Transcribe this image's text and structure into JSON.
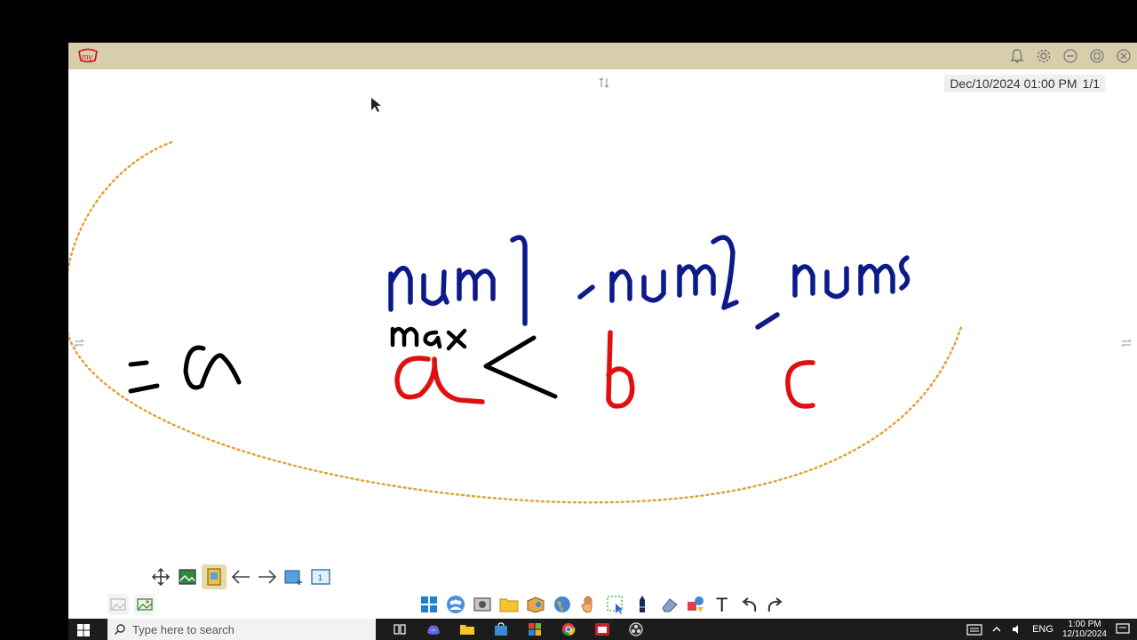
{
  "window": {
    "logo_text": "my",
    "title_icons": [
      "bell-icon",
      "gear-icon",
      "minimize-icon",
      "restore-icon",
      "close-icon"
    ]
  },
  "datestamp": {
    "datetime": "Dec/10/2024 01:00 PM",
    "page": "1/1"
  },
  "page_toolbar": {
    "icons": [
      "move-icon",
      "screenshot-icon",
      "page-list-icon",
      "arrow-left-icon",
      "arrow-right-icon",
      "add-page-icon",
      "page-number-icon"
    ],
    "active_index": 2,
    "page_number": "1"
  },
  "main_toolbar": {
    "icons": [
      "windows-icon",
      "people-icon",
      "camera-icon",
      "folder-icon",
      "box-icon",
      "globe-icon",
      "hand-icon",
      "select-icon",
      "pen-icon",
      "eraser-icon",
      "shapes-icon",
      "text-icon",
      "undo-icon",
      "redo-icon"
    ],
    "text_glyph": "T"
  },
  "taskbar": {
    "search_placeholder": "Type here to search",
    "apps": [
      "task-view-icon",
      "copilot-icon",
      "file-explorer-icon",
      "store-icon",
      "office-icon",
      "chrome-icon",
      "myviewboard-icon",
      "obs-icon"
    ],
    "language": "ENG",
    "time": "1:00 PM",
    "date": "12/10/2024"
  },
  "colors": {
    "titlebar": "#d9ceac",
    "ink_blue": "#0d1a8a",
    "ink_red": "#e01010",
    "ink_black": "#000000",
    "lasso": "#e0a030"
  }
}
